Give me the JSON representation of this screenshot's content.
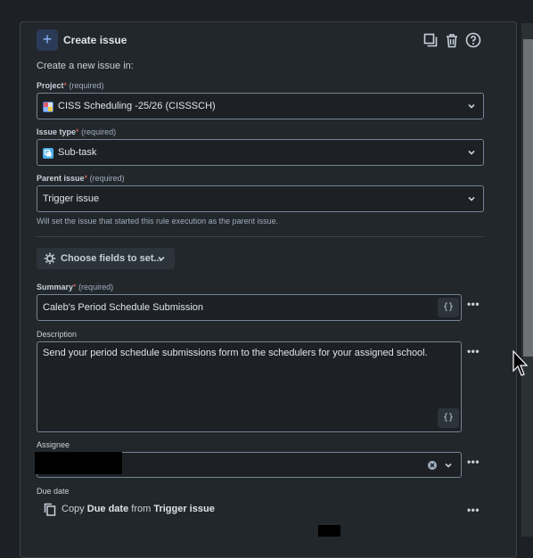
{
  "header": {
    "title": "Create issue",
    "subtitle": "Create a new issue in:"
  },
  "fields": {
    "project": {
      "label": "Project",
      "required_text": "(required)",
      "value": "CISS Scheduling -25/26 (CISSSCH)"
    },
    "issue_type": {
      "label": "Issue type",
      "required_text": "(required)",
      "value": "Sub-task"
    },
    "parent_issue": {
      "label": "Parent issue",
      "required_text": "(required)",
      "value": "Trigger issue",
      "help": "Will set the issue that started this rule execution as the parent issue."
    },
    "summary": {
      "label": "Summary",
      "required_text": "(required)",
      "value": "Caleb's Period Schedule Submission"
    },
    "description": {
      "label": "Description",
      "value": "Send your period schedule submissions form to the schedulers for your assigned school."
    },
    "assignee": {
      "label": "Assignee"
    },
    "due_date": {
      "label": "Due date",
      "copy_prefix": "Copy",
      "copy_field": "Due date",
      "copy_from": "from",
      "copy_source": "Trigger issue"
    }
  },
  "choose_fields": {
    "label": "Choose fields to set..."
  },
  "braces_label": "{}",
  "more_label": "•••",
  "required_marker": "*",
  "colors": {
    "background": "#1d2125",
    "panel": "#22272b",
    "accent": "#579dff",
    "required": "#f87168"
  },
  "icons": [
    "plus-icon",
    "duplicate-icon",
    "trash-icon",
    "help-icon",
    "chevron-down-icon",
    "gear-icon",
    "clear-icon",
    "copy-icon",
    "project-avatar-icon",
    "subtask-icon"
  ]
}
